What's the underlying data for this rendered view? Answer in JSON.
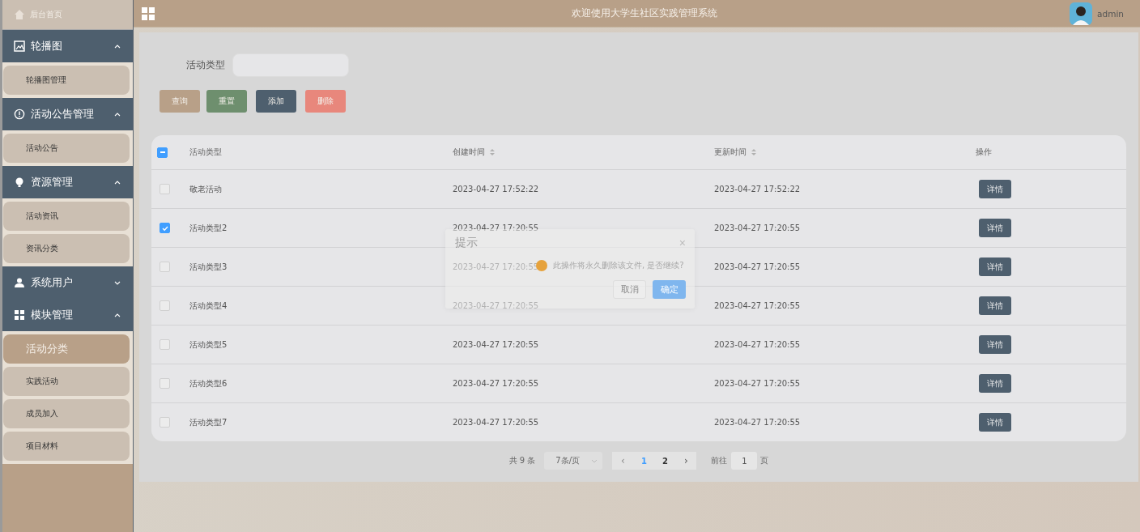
{
  "header": {
    "title": "欢迎使用大学生社区实践管理系统",
    "user": "admin"
  },
  "sidebar": {
    "home": "后台首页",
    "groups": [
      {
        "label": "轮播图",
        "expanded": true,
        "items": [
          {
            "label": "轮播图管理",
            "selected": false
          }
        ]
      },
      {
        "label": "活动公告管理",
        "expanded": true,
        "items": [
          {
            "label": "活动公告",
            "selected": false
          }
        ]
      },
      {
        "label": "资源管理",
        "expanded": true,
        "items": [
          {
            "label": "活动资讯",
            "selected": false
          },
          {
            "label": "资讯分类",
            "selected": false
          }
        ]
      },
      {
        "label": "系统用户",
        "expanded": false
      },
      {
        "label": "模块管理",
        "expanded": true,
        "items": [
          {
            "label": "活动分类",
            "selected": true
          },
          {
            "label": "实践活动",
            "selected": false
          },
          {
            "label": "成员加入",
            "selected": false
          },
          {
            "label": "项目材料",
            "selected": false
          }
        ]
      }
    ]
  },
  "search": {
    "label": "活动类型"
  },
  "buttons": [
    {
      "label": "查询",
      "kind": "query"
    },
    {
      "label": "重置",
      "kind": "reset"
    },
    {
      "label": "添加",
      "kind": "add"
    },
    {
      "label": "删除",
      "kind": "delete"
    }
  ],
  "table": {
    "select_all": {
      "indeterminate": true
    },
    "columns": [
      {
        "label": "活动类型",
        "sortable": false
      },
      {
        "label": "创建时间",
        "sortable": true
      },
      {
        "label": "更新时间",
        "sortable": true
      },
      {
        "label": "操作",
        "sortable": false
      }
    ],
    "rows": [
      {
        "checked": false,
        "type": "敬老活动",
        "created": "2023-04-27 17:52:22",
        "updated": "2023-04-27 17:52:22",
        "action": "详情"
      },
      {
        "checked": true,
        "type": "活动类型2",
        "created": "2023-04-27 17:20:55",
        "updated": "2023-04-27 17:20:55",
        "action": "详情"
      },
      {
        "checked": false,
        "type": "活动类型3",
        "created": "2023-04-27 17:20:55",
        "updated": "2023-04-27 17:20:55",
        "action": "详情"
      },
      {
        "checked": false,
        "type": "活动类型4",
        "created": "2023-04-27 17:20:55",
        "updated": "2023-04-27 17:20:55",
        "action": "详情"
      },
      {
        "checked": false,
        "type": "活动类型5",
        "created": "2023-04-27 17:20:55",
        "updated": "2023-04-27 17:20:55",
        "action": "详情"
      },
      {
        "checked": false,
        "type": "活动类型6",
        "created": "2023-04-27 17:20:55",
        "updated": "2023-04-27 17:20:55",
        "action": "详情"
      },
      {
        "checked": false,
        "type": "活动类型7",
        "created": "2023-04-27 17:20:55",
        "updated": "2023-04-27 17:20:55",
        "action": "详情"
      }
    ]
  },
  "pagination": {
    "total": "共 9 条",
    "page_size": "7条/页",
    "prev": {
      "label": "‹",
      "disabled": true
    },
    "pages": [
      {
        "label": "1",
        "selected": true
      },
      {
        "label": "2",
        "selected": false
      }
    ],
    "next": {
      "label": "›",
      "disabled": false
    },
    "goto_label": "前往",
    "goto_value": "1",
    "goto_suffix": "页"
  },
  "dialog": {
    "title": "提示",
    "close": "×",
    "message": "此操作将永久删除该文件, 是否继续?",
    "cancel": "取消",
    "confirm": "确定"
  }
}
